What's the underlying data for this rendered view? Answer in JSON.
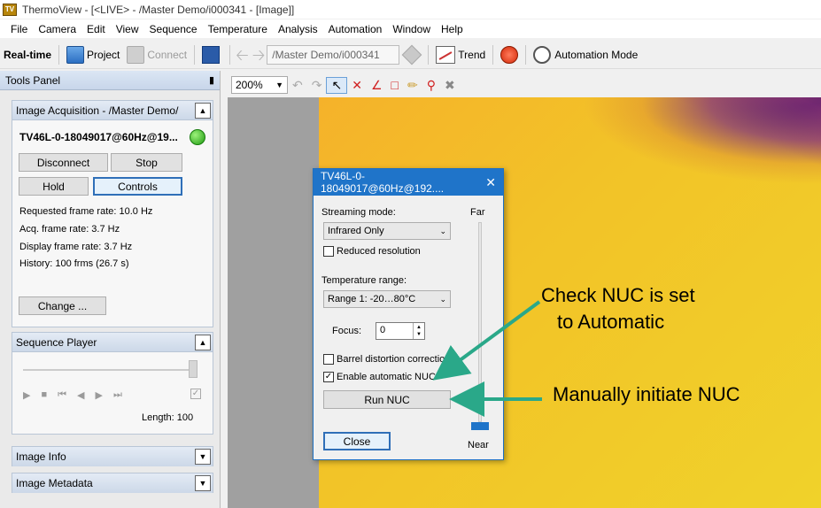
{
  "window": {
    "title": "ThermoView - [<LIVE> - /Master Demo/i000341 - [Image]]",
    "app_icon": "TV"
  },
  "menu": [
    "File",
    "Camera",
    "Edit",
    "View",
    "Sequence",
    "Temperature",
    "Analysis",
    "Automation",
    "Window",
    "Help"
  ],
  "toolbar": {
    "realtime": "Real-time",
    "project": "Project",
    "connect": "Connect",
    "path": "/Master Demo/i000341",
    "trend": "Trend",
    "automation_mode": "Automation Mode"
  },
  "tools_panel": {
    "title": "Tools Panel",
    "acquisition": {
      "header": "Image Acquisition - /Master Demo/",
      "device": "TV46L-0-18049017@60Hz@19...",
      "disconnect": "Disconnect",
      "stop": "Stop",
      "hold": "Hold",
      "controls": "Controls",
      "requested_rate": "Requested frame rate: 10.0 Hz",
      "acq_rate": "Acq. frame rate: 3.7 Hz",
      "display_rate": "Display frame rate: 3.7 Hz",
      "history": "History: 100 frms (26.7 s)",
      "change": "Change ..."
    },
    "sequence_player": {
      "header": "Sequence Player",
      "length": "Length: 100"
    },
    "image_info": {
      "header": "Image Info"
    },
    "image_metadata": {
      "header": "Image Metadata"
    }
  },
  "image_toolbar": {
    "zoom": "200%"
  },
  "dialog": {
    "title": "TV46L-0-18049017@60Hz@192....",
    "far": "Far",
    "near": "Near",
    "streaming_label": "Streaming mode:",
    "streaming_value": "Infrared Only",
    "reduced_resolution": "Reduced resolution",
    "temp_label": "Temperature range:",
    "temp_value": "Range 1: -20…80°C",
    "focus_label": "Focus:",
    "focus_value": "0",
    "barrel": "Barrel distortion correction",
    "auto_nuc": "Enable automatic NUC",
    "run_nuc": "Run NUC",
    "close": "Close"
  },
  "annotations": {
    "check_nuc_line1": "Check NUC is set",
    "check_nuc_line2": "to Automatic",
    "manual_nuc": "Manually initiate NUC",
    "arrow_color": "#2aa889"
  },
  "colors": {
    "dialog_title": "#1f74c9",
    "focus_border": "#2f6fb8",
    "status_ok": "#1f9a12"
  }
}
